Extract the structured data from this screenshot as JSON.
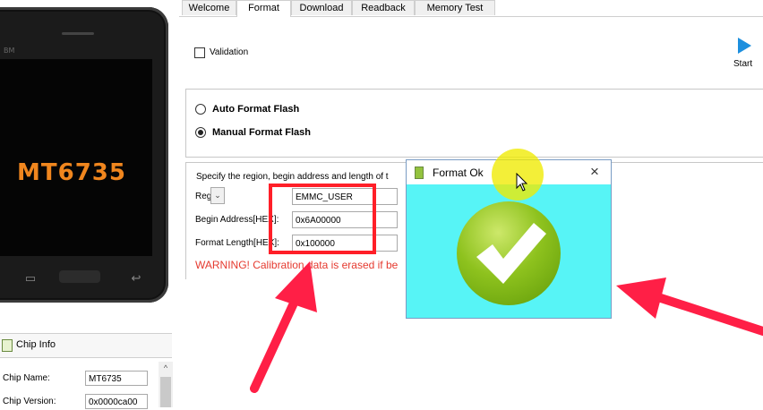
{
  "device": {
    "brand": "BM",
    "model": "MT6735"
  },
  "chip_info": {
    "title": "Chip Info",
    "rows": [
      {
        "label": "Chip Name:",
        "value": "MT6735"
      },
      {
        "label": "Chip Version:",
        "value": "0x0000ca00"
      }
    ]
  },
  "tabs": [
    {
      "label": "Welcome"
    },
    {
      "label": "Format"
    },
    {
      "label": "Download"
    },
    {
      "label": "Readback"
    },
    {
      "label": "Memory Test"
    }
  ],
  "active_tab": "Format",
  "format": {
    "validation_label": "Validation",
    "validation_checked": false,
    "start_label": "Start",
    "auto_label": "Auto Format Flash",
    "manual_label": "Manual Format Flash",
    "selected_mode": "manual",
    "region_description": "Specify the region, begin address and length of t",
    "region_label": "Region",
    "region_value": "EMMC_USER",
    "begin_label": "Begin Address[HEX]:",
    "begin_value": "0x6A00000",
    "length_label": "Format Length[HEX]:",
    "length_value": "0x100000",
    "warning": "WARNING! Calibration data is erased if be"
  },
  "dialog": {
    "title": "Format Ok",
    "close_symbol": "×"
  },
  "colors": {
    "accent_blue": "#1d8fde",
    "warning_red": "#e53a2f",
    "annotation_red": "#ff1f28",
    "dialog_body": "#57f4f6",
    "check_green": "#8ec21e",
    "highlight_yellow": "#f0eb00",
    "chip_model_orange": "#f0861e"
  },
  "icons": {
    "start": "play-triangle-icon",
    "dialog": "app-icon",
    "success": "checkmark-icon",
    "chip": "chip-icon"
  }
}
